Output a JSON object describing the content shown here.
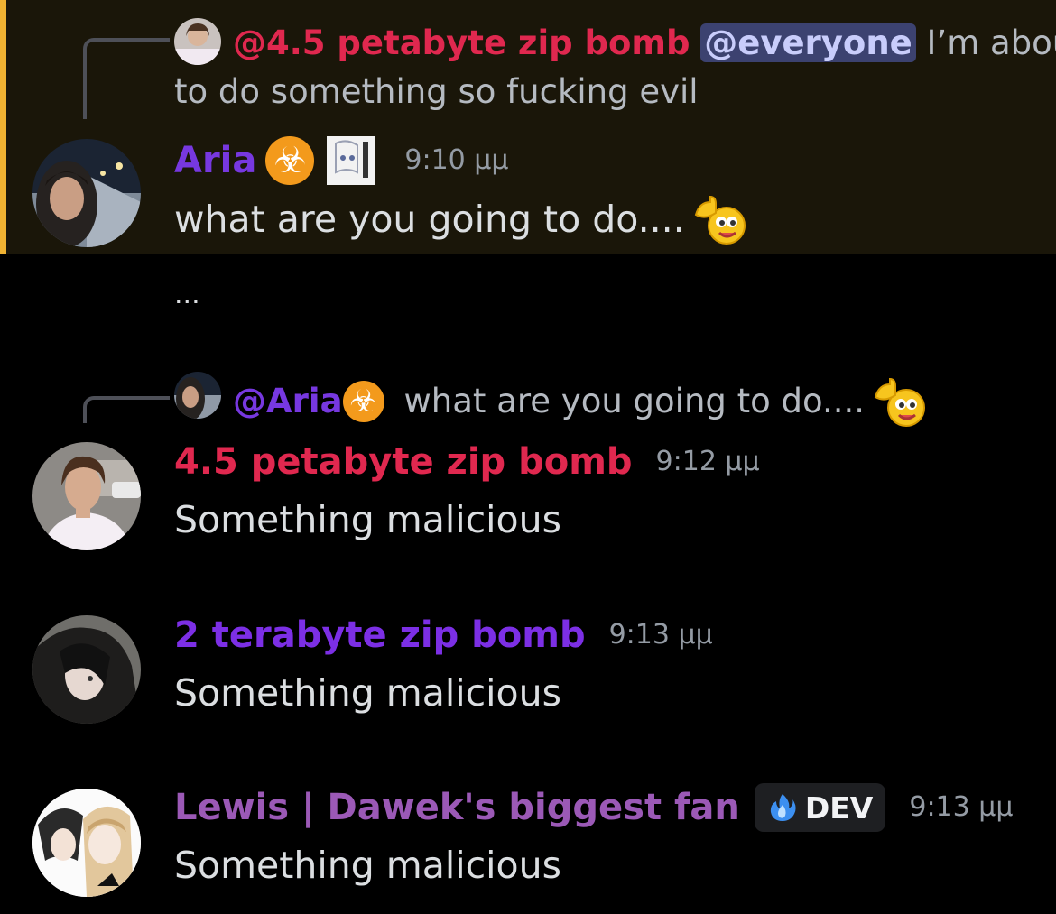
{
  "colors": {
    "highlight_bg": "#1a1609",
    "highlight_bar": "#f0b232",
    "red_user": "#e0284f",
    "purple_user": "#7c2fe5",
    "aria_user": "#7738e0",
    "lewis_user": "#9b59b6",
    "everyone_bg": "#3c4270"
  },
  "messages": [
    {
      "reply": {
        "mention": "@4.5 petabyte zip bomb",
        "everyone": "@everyone",
        "text_line1": "I’m about",
        "text_line2": "to do something so fucking evil"
      },
      "author": "Aria",
      "author_icons": [
        "biohazard-emoji",
        "manga-badge-icon"
      ],
      "timestamp": "9:10 μμ",
      "content": "what are you going to do...."
    },
    {
      "content": "..."
    },
    {
      "reply": {
        "mention": "@Aria",
        "text": "what are you going to do...."
      },
      "author": "4.5 petabyte zip bomb",
      "timestamp": "9:12 μμ",
      "content": "Something malicious"
    },
    {
      "author": "2 terabyte zip bomb",
      "timestamp": "9:13 μμ",
      "content": "Something malicious"
    },
    {
      "author": "Lewis | Dawek's biggest fan",
      "badge": "DEV",
      "timestamp": "9:13 μμ",
      "content": "Something malicious"
    }
  ]
}
